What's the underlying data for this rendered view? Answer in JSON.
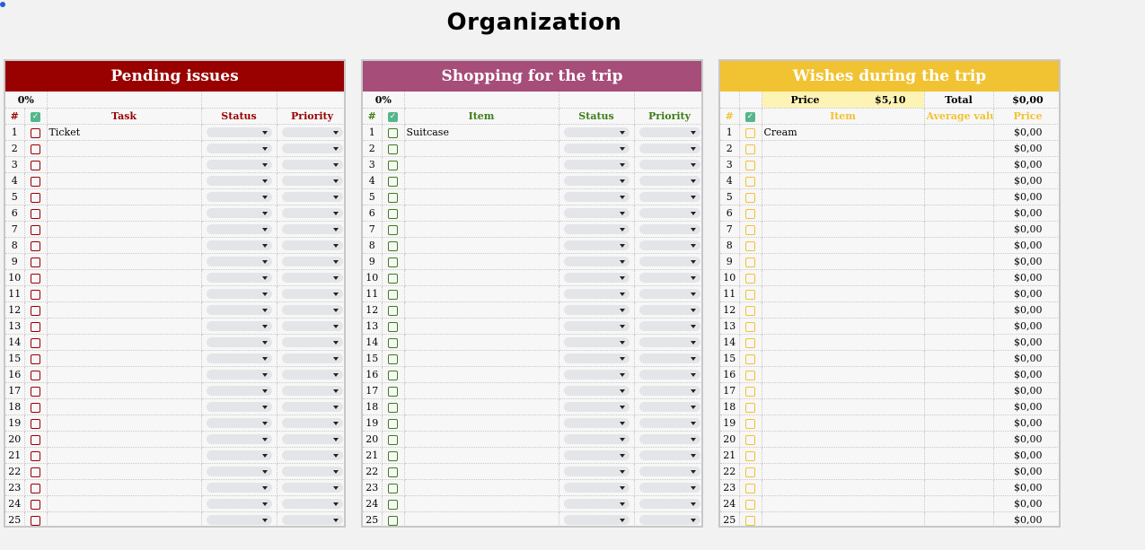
{
  "page_title": "Organization",
  "colors": {
    "red": "#990000",
    "purple": "#a64d79",
    "yellow": "#f1c232",
    "green": "#3e7d1a",
    "checkbox_header": "#55b58b"
  },
  "panels": [
    {
      "title": "Pending issues",
      "progress": "0%",
      "headers": {
        "number": "#",
        "item": "Task",
        "status": "Status",
        "priority": "Priority"
      },
      "items": [
        "Ticket",
        "",
        "",
        "",
        "",
        "",
        "",
        "",
        "",
        "",
        "",
        "",
        "",
        "",
        "",
        "",
        "",
        "",
        "",
        "",
        "",
        "",
        "",
        "",
        ""
      ]
    },
    {
      "title": "Shopping for the trip",
      "progress": "0%",
      "headers": {
        "number": "#",
        "item": "Item",
        "status": "Status",
        "priority": "Priority"
      },
      "items": [
        "Suitcase",
        "",
        "",
        "",
        "",
        "",
        "",
        "",
        "",
        "",
        "",
        "",
        "",
        "",
        "",
        "",
        "",
        "",
        "",
        "",
        "",
        "",
        "",
        "",
        ""
      ]
    },
    {
      "title": "Wishes during the trip",
      "price_label": "Price",
      "price_value": "$5,10",
      "total_label": "Total",
      "total_value": "$0,00",
      "headers": {
        "number": "#",
        "item": "Item",
        "average": "Average value",
        "price": "Price"
      },
      "items": [
        "Cream",
        "",
        "",
        "",
        "",
        "",
        "",
        "",
        "",
        "",
        "",
        "",
        "",
        "",
        "",
        "",
        "",
        "",
        "",
        "",
        "",
        "",
        "",
        "",
        ""
      ],
      "prices": [
        "$0,00",
        "$0,00",
        "$0,00",
        "$0,00",
        "$0,00",
        "$0,00",
        "$0,00",
        "$0,00",
        "$0,00",
        "$0,00",
        "$0,00",
        "$0,00",
        "$0,00",
        "$0,00",
        "$0,00",
        "$0,00",
        "$0,00",
        "$0,00",
        "$0,00",
        "$0,00",
        "$0,00",
        "$0,00",
        "$0,00",
        "$0,00",
        "$0,00"
      ]
    }
  ]
}
